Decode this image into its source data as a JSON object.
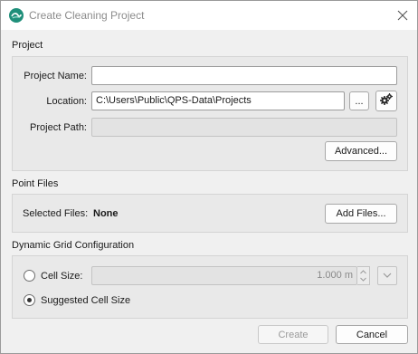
{
  "window": {
    "title": "Create Cleaning Project"
  },
  "project": {
    "section_title": "Project",
    "name_label": "Project Name:",
    "name_value": "",
    "location_label": "Location:",
    "location_value": "C:\\Users\\Public\\QPS-Data\\Projects",
    "browse_label": "...",
    "path_label": "Project Path:",
    "path_value": "",
    "advanced_label": "Advanced..."
  },
  "point_files": {
    "section_title": "Point Files",
    "selected_label": "Selected Files:",
    "selected_value": "None",
    "add_label": "Add Files..."
  },
  "grid": {
    "section_title": "Dynamic Grid Configuration",
    "cell_size_label": "Cell Size:",
    "cell_size_value": "1.000 m",
    "cell_size_selected": false,
    "suggested_label": "Suggested Cell Size",
    "suggested_selected": true
  },
  "footer": {
    "create_label": "Create",
    "cancel_label": "Cancel"
  },
  "icons": {
    "app": "qps-app-icon",
    "close": "close-icon",
    "settings": "gears-icon",
    "chevron": "chevron-down-icon"
  },
  "colors": {
    "app_icon_bg": "#1f8f7a",
    "window_bg": "#f0f0f0",
    "group_bg": "#e9e9e9"
  }
}
